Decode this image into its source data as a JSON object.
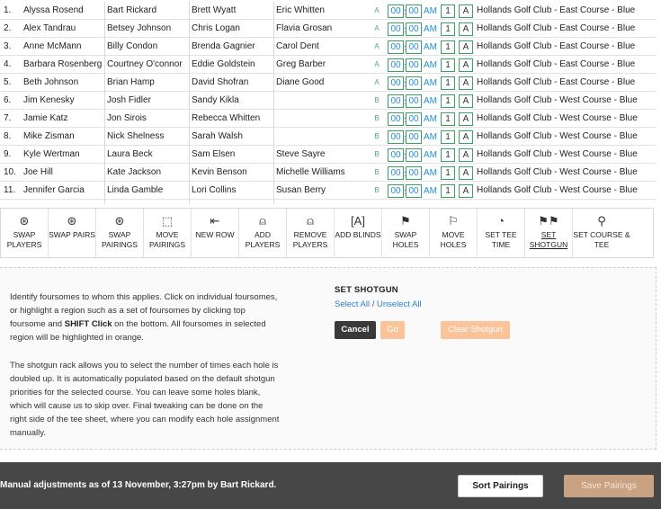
{
  "pairings": [
    {
      "index": "1.",
      "players": [
        "Alyssa Rosend",
        "Bart Rickard",
        "Brett Wyatt",
        "Eric Whitten"
      ],
      "group": "A",
      "hour": "00",
      "minute": "00",
      "ampm": "AM",
      "hole": "1",
      "tee": "A",
      "course": "Hollands Golf Club - East Course - Blue"
    },
    {
      "index": "2.",
      "players": [
        "Alex Tandrau",
        "Betsey Johnson",
        "Chris Logan",
        "Flavia Grosan"
      ],
      "group": "A",
      "hour": "00",
      "minute": "00",
      "ampm": "AM",
      "hole": "1",
      "tee": "A",
      "course": "Hollands Golf Club - East Course - Blue"
    },
    {
      "index": "3.",
      "players": [
        "Anne McMann",
        "Billy Condon",
        "Brenda Gagnier",
        "Carol Dent"
      ],
      "group": "A",
      "hour": "00",
      "minute": "00",
      "ampm": "AM",
      "hole": "1",
      "tee": "A",
      "course": "Hollands Golf Club - East Course - Blue"
    },
    {
      "index": "4.",
      "players": [
        "Barbara Rosenberg",
        "Courtney O'connor",
        "Eddie Goldstein",
        "Greg Barber"
      ],
      "group": "A",
      "hour": "00",
      "minute": "00",
      "ampm": "AM",
      "hole": "1",
      "tee": "A",
      "course": "Hollands Golf Club - East Course - Blue"
    },
    {
      "index": "5.",
      "players": [
        "Beth Johnson",
        "Brian Hamp",
        "David Shofran",
        "Diane Good"
      ],
      "group": "A",
      "hour": "00",
      "minute": "00",
      "ampm": "AM",
      "hole": "1",
      "tee": "A",
      "course": "Hollands Golf Club - East Course - Blue"
    },
    {
      "index": "6.",
      "players": [
        "Jim Kenesky",
        "Josh Fidler",
        "Sandy Kikla",
        ""
      ],
      "group": "B",
      "hour": "00",
      "minute": "00",
      "ampm": "AM",
      "hole": "1",
      "tee": "A",
      "course": "Hollands Golf Club - West Course - Blue"
    },
    {
      "index": "7.",
      "players": [
        "Jamie Katz",
        "Jon Sirois",
        "Rebecca Whitten",
        ""
      ],
      "group": "B",
      "hour": "00",
      "minute": "00",
      "ampm": "AM",
      "hole": "1",
      "tee": "A",
      "course": "Hollands Golf Club - West Course - Blue"
    },
    {
      "index": "8.",
      "players": [
        "Mike Zisman",
        "Nick Shelness",
        "Sarah Walsh",
        ""
      ],
      "group": "B",
      "hour": "00",
      "minute": "00",
      "ampm": "AM",
      "hole": "1",
      "tee": "A",
      "course": "Hollands Golf Club - West Course - Blue"
    },
    {
      "index": "9.",
      "players": [
        "Kyle Wertman",
        "Laura Beck",
        "Sam Elsen",
        "Steve Sayre"
      ],
      "group": "B",
      "hour": "00",
      "minute": "00",
      "ampm": "AM",
      "hole": "1",
      "tee": "A",
      "course": "Hollands Golf Club - West Course - Blue"
    },
    {
      "index": "10.",
      "players": [
        "Joe Hill",
        "Kate Jackson",
        "Kevin Benson",
        "Michelle Williams"
      ],
      "group": "B",
      "hour": "00",
      "minute": "00",
      "ampm": "AM",
      "hole": "1",
      "tee": "A",
      "course": "Hollands Golf Club - West Course - Blue"
    },
    {
      "index": "11.",
      "players": [
        "Jennifer Garcia",
        "Linda Gamble",
        "Lori Collins",
        "Susan Berry"
      ],
      "group": "B",
      "hour": "00",
      "minute": "00",
      "ampm": "AM",
      "hole": "1",
      "tee": "A",
      "course": "Hollands Golf Club - West Course - Blue"
    }
  ],
  "toolbar": [
    {
      "name": "swap-players",
      "icon": "swap-players-icon",
      "glyph": "⊛",
      "label": "SWAP PLAYERS"
    },
    {
      "name": "swap-pairs",
      "icon": "swap-pairs-icon",
      "glyph": "⊛",
      "label": "SWAP PAIRS"
    },
    {
      "name": "swap-pairings",
      "icon": "swap-pairings-icon",
      "glyph": "⊛",
      "label": "SWAP PAIRINGS"
    },
    {
      "name": "move-pairings",
      "icon": "move-pairings-icon",
      "glyph": "⬚",
      "label": "MOVE PAIRINGS"
    },
    {
      "name": "new-row",
      "icon": "new-row-icon",
      "glyph": "⇤",
      "label": "NEW ROW"
    },
    {
      "name": "add-players",
      "icon": "add-players-icon",
      "glyph": "⍝",
      "label": "ADD PLAYERS"
    },
    {
      "name": "remove-players",
      "icon": "remove-players-icon",
      "glyph": "⍝",
      "label": "REMOVE PLAYERS"
    },
    {
      "name": "add-blinds",
      "icon": "add-blinds-icon",
      "glyph": "[A]",
      "label": "ADD BLINDS"
    },
    {
      "name": "swap-holes",
      "icon": "swap-holes-icon",
      "glyph": "⚑",
      "label": "SWAP HOLES"
    },
    {
      "name": "move-holes",
      "icon": "move-holes-icon",
      "glyph": "⚐",
      "label": "MOVE HOLES"
    },
    {
      "name": "set-tee-time",
      "icon": "clock-icon",
      "glyph": "◔",
      "label": "SET TEE TIME"
    },
    {
      "name": "set-shotgun",
      "icon": "checkered-flags-icon",
      "glyph": "⚑⚑",
      "label": "SET SHOTGUN",
      "active": true
    },
    {
      "name": "set-course-tee",
      "icon": "map-pin-icon",
      "glyph": "⚲",
      "label": "SET COURSE & TEE"
    }
  ],
  "panel": {
    "instructions_1_a": "Identify foursomes to whom this applies. Click on individual foursomes, or highlight a region such as a set of foursomes by clicking top foursome and ",
    "instructions_1_bold": "SHIFT Click",
    "instructions_1_b": " on the bottom. All foursomes in selected region will be highlighted in orange.",
    "instructions_2": "The shotgun rack allows you to select the number of times each hole is doubled up. It is automatically populated based on the default shotgun priorities for the selected course. You can leave some holes blank, which will cause us to skip over. Final tweaking can be done on the right side of the tee sheet, where you can modify each hole assignment manually.",
    "title": "SET SHOTGUN",
    "select_all": "Select All",
    "separator": "/",
    "unselect_all": "Unselect All",
    "cancel": "Cancel",
    "go": "Go",
    "clear_shotgun": "Clear Shotgun"
  },
  "footer": {
    "adjustments_text": "Manual adjustments as of 13 November, 3:27pm by Bart Rickard.",
    "sort_button": "Sort Pairings",
    "save_button": "Save Pairings"
  },
  "colors": {
    "accent_green": "#3aa263",
    "time_blue": "#1f8fd0",
    "link_blue": "#2a7fd0",
    "orange_disabled": "#fbc39a",
    "footer_bg": "#474747"
  }
}
